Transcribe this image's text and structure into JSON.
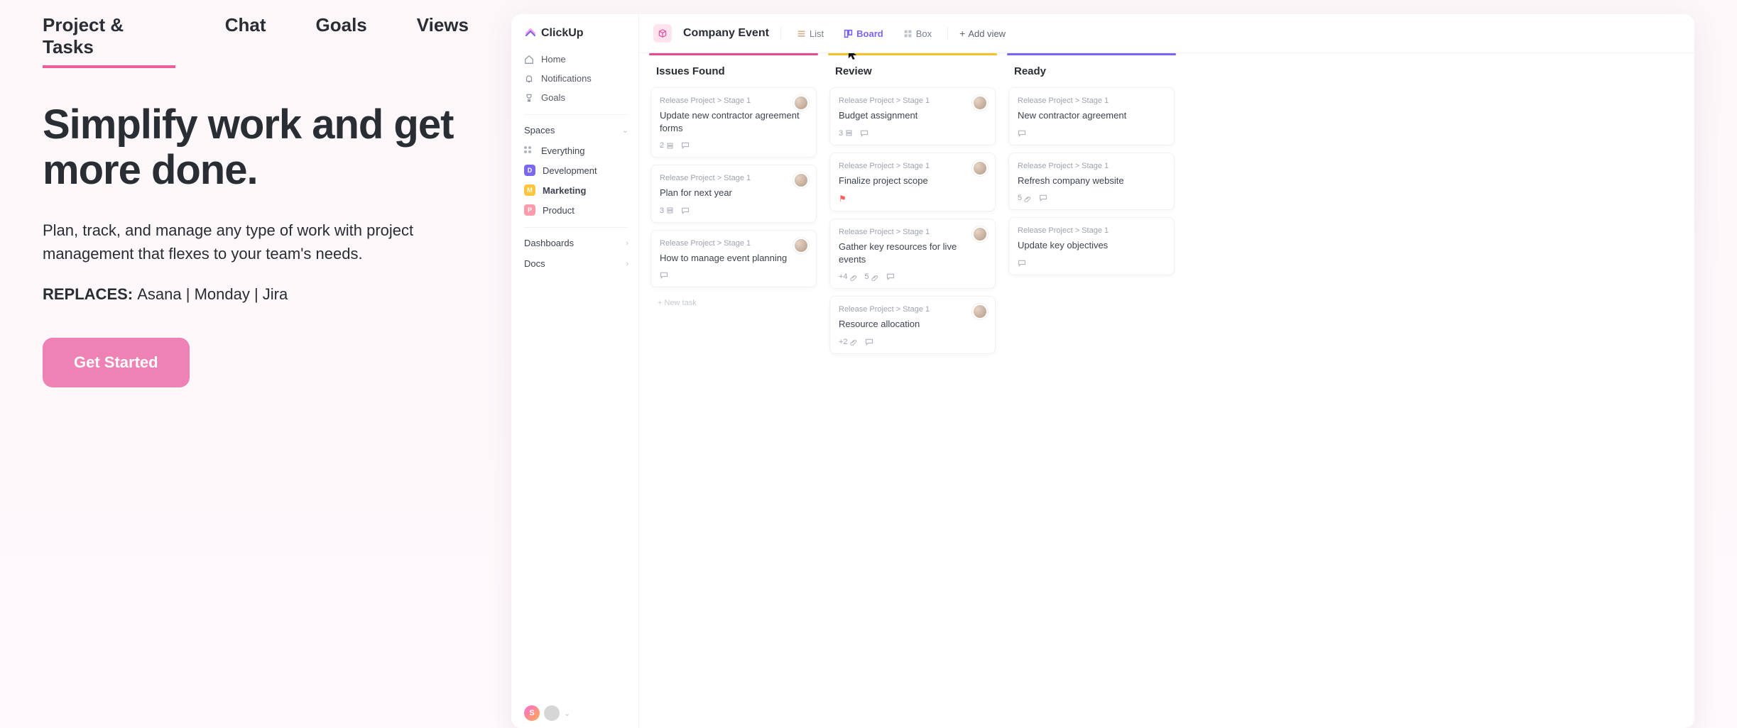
{
  "nav_tabs": {
    "items": [
      "Project & Tasks",
      "Chat",
      "Goals",
      "Views"
    ],
    "active_index": 0
  },
  "hero": {
    "title": "Simplify work and get more done.",
    "subtitle": "Plan, track, and manage any type of work with project management that flexes to your team's needs.",
    "replaces_label": "REPLACES",
    "replaces_value": "Asana | Monday | Jira",
    "cta_label": "Get Started"
  },
  "sidebar": {
    "logo_text": "ClickUp",
    "nav": [
      {
        "label": "Home",
        "icon": "home"
      },
      {
        "label": "Notifications",
        "icon": "bell"
      },
      {
        "label": "Goals",
        "icon": "trophy"
      }
    ],
    "spaces_label": "Spaces",
    "everything_label": "Everything",
    "spaces": [
      {
        "letter": "D",
        "label": "Development",
        "class": "dev",
        "active": false
      },
      {
        "letter": "M",
        "label": "Marketing",
        "class": "mkt",
        "active": true
      },
      {
        "letter": "P",
        "label": "Product",
        "class": "prod",
        "active": false
      }
    ],
    "dashboards_label": "Dashboards",
    "docs_label": "Docs",
    "workspace_letter": "S"
  },
  "main": {
    "space_title": "Company Event",
    "views": {
      "list_label": "List",
      "board_label": "Board",
      "box_label": "Box",
      "add_label": "Add view"
    }
  },
  "board": {
    "columns": [
      {
        "title": "Issues Found",
        "accent": "pink",
        "new_task_label": "+ New task",
        "cards": [
          {
            "breadcrumb": "Release Project > Stage 1",
            "title": "Update new contractor agreement forms",
            "subtasks": "2",
            "has_comments": true,
            "has_avatar": true
          },
          {
            "breadcrumb": "Release Project > Stage 1",
            "title": "Plan for next year",
            "subtasks": "3",
            "has_comments": true,
            "has_avatar": true
          },
          {
            "breadcrumb": "Release Project > Stage 1",
            "title": "How to manage event planning",
            "has_comments": true,
            "has_avatar": true
          }
        ]
      },
      {
        "title": "Review",
        "accent": "yellow",
        "cards": [
          {
            "breadcrumb": "Release Project > Stage 1",
            "title": "Budget assignment",
            "subtasks": "3",
            "has_comments": true,
            "has_avatar": true
          },
          {
            "breadcrumb": "Release Project > Stage 1",
            "title": "Finalize project scope",
            "flag": true,
            "has_avatar": true
          },
          {
            "breadcrumb": "Release Project > Stage 1",
            "title": "Gather key resources for live events",
            "attachments_extra": "+4",
            "attachments": "5",
            "has_comments": true,
            "has_avatar": true
          },
          {
            "breadcrumb": "Release Project > Stage 1",
            "title": "Resource allocation",
            "attachments_extra": "+2",
            "has_comments": true,
            "has_avatar": true
          }
        ]
      },
      {
        "title": "Ready",
        "accent": "blue",
        "cards": [
          {
            "breadcrumb": "Release Project > Stage 1",
            "title": "New contractor agreement",
            "has_comments": true
          },
          {
            "breadcrumb": "Release Project > Stage 1",
            "title": "Refresh company website",
            "attachments": "5",
            "has_comments": true
          },
          {
            "breadcrumb": "Release Project > Stage 1",
            "title": "Update key objectives",
            "has_comments": true
          }
        ]
      }
    ]
  }
}
